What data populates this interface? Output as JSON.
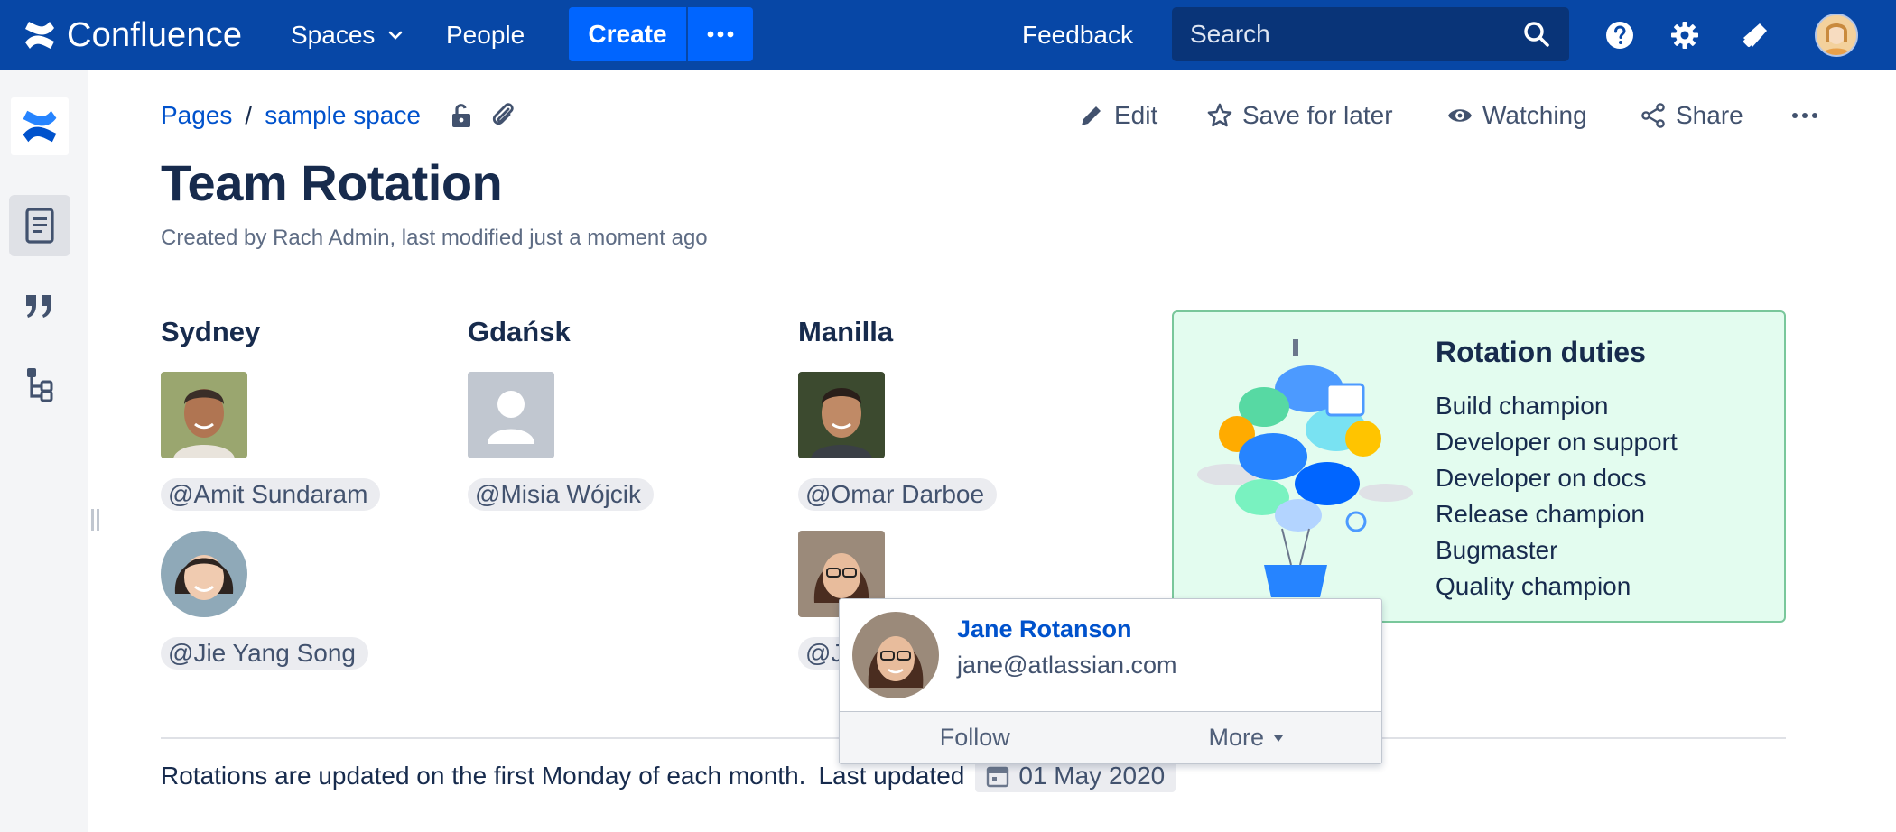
{
  "topnav": {
    "brand": "Confluence",
    "spaces_label": "Spaces",
    "people_label": "People",
    "create_label": "Create",
    "feedback_label": "Feedback",
    "search_placeholder": "Search"
  },
  "breadcrumb": {
    "root": "Pages",
    "separator": "/",
    "space": "sample space"
  },
  "actions": {
    "edit_label": "Edit",
    "save_for_later_label": "Save for later",
    "watching_label": "Watching",
    "share_label": "Share"
  },
  "page": {
    "title": "Team Rotation",
    "byline": "Created by Rach Admin, last modified just a moment ago"
  },
  "columns": [
    {
      "heading": "Sydney",
      "people": [
        "Amit Sundaram",
        "Jie Yang Song"
      ]
    },
    {
      "heading": "Gdańsk",
      "people": [
        "Misia Wójcik"
      ]
    },
    {
      "heading": "Manilla",
      "people": [
        "Omar Darboe",
        "J"
      ]
    }
  ],
  "mention_prefix": "@",
  "duties": {
    "title": "Rotation duties",
    "items": [
      "Build champion",
      "Developer on support",
      "Developer on docs",
      "Release champion",
      "Bugmaster",
      "Quality champion"
    ]
  },
  "footer": {
    "note": "Rotations are updated on the first Monday of each month.",
    "last_updated_label": "Last updated",
    "date": "01 May 2020"
  },
  "hovercard": {
    "name": "Jane Rotanson",
    "email": "jane@atlassian.com",
    "follow_label": "Follow",
    "more_label": "More"
  },
  "colors": {
    "nav_bg": "#0747a6",
    "create_bg": "#0065ff",
    "link": "#0052cc",
    "panel_bg": "#e3fcef",
    "panel_border": "#79c79b"
  }
}
